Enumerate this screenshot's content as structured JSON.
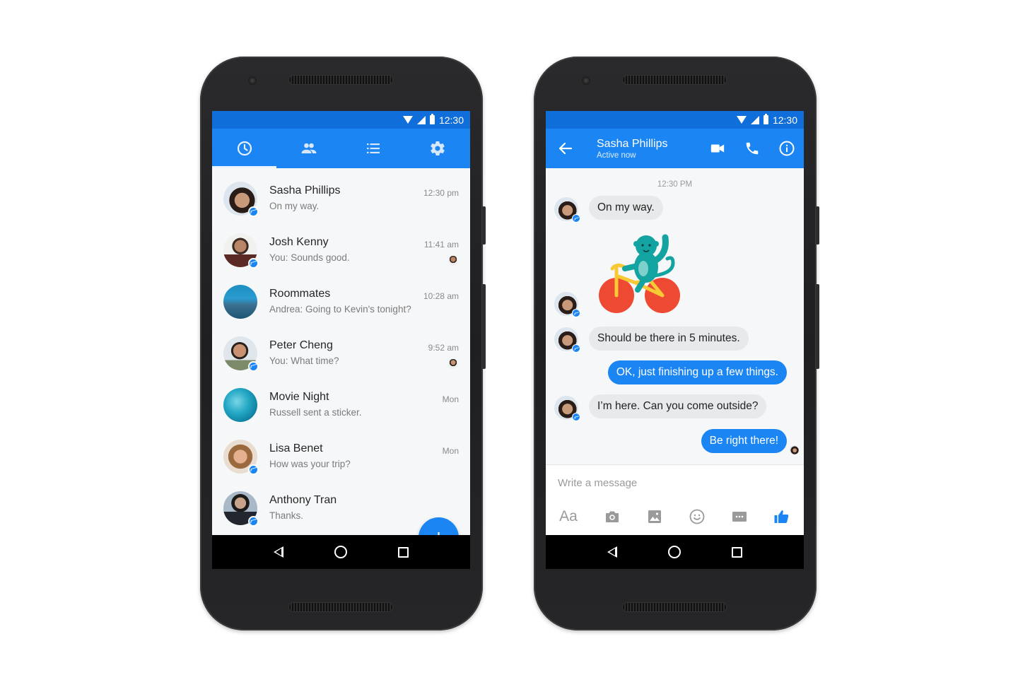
{
  "colors": {
    "accent": "#1a85f3",
    "statusbar": "#0f6ed9",
    "bubble_in": "#e8e9eb",
    "bubble_out": "#1a85f3",
    "phone_body": "#242426"
  },
  "status_bar": {
    "time": "12:30",
    "icons": [
      "wifi-icon",
      "signal-icon",
      "battery-icon"
    ]
  },
  "left_screen": {
    "tabs": [
      {
        "name": "recent",
        "icon": "clock-icon",
        "active": true
      },
      {
        "name": "people",
        "icon": "people-icon",
        "active": false
      },
      {
        "name": "groups",
        "icon": "list-icon",
        "active": false
      },
      {
        "name": "settings",
        "icon": "gear-icon",
        "active": false
      }
    ],
    "conversations": [
      {
        "name": "Sasha Phillips",
        "snippet": "On my way.",
        "time": "12:30 pm",
        "messenger_badge": true,
        "seen_avatar": false
      },
      {
        "name": "Josh Kenny",
        "snippet": "You: Sounds good.",
        "time": "11:41 am",
        "messenger_badge": true,
        "seen_avatar": true
      },
      {
        "name": "Roommates",
        "snippet": "Andrea: Going to Kevin's tonight?",
        "time": "10:28 am",
        "messenger_badge": false,
        "seen_avatar": false
      },
      {
        "name": "Peter Cheng",
        "snippet": "You: What time?",
        "time": "9:52 am",
        "messenger_badge": true,
        "seen_avatar": true
      },
      {
        "name": "Movie Night",
        "snippet": "Russell sent a sticker.",
        "time": "Mon",
        "messenger_badge": false,
        "seen_avatar": false
      },
      {
        "name": "Lisa Benet",
        "snippet": "How was your trip?",
        "time": "Mon",
        "messenger_badge": true,
        "seen_avatar": false
      },
      {
        "name": "Anthony Tran",
        "snippet": "Thanks.",
        "time": "",
        "messenger_badge": true,
        "seen_avatar": false
      }
    ],
    "fab_label": "+"
  },
  "right_screen": {
    "contact_name": "Sasha Phillips",
    "contact_status": "Active now",
    "header_actions": [
      "video-call-icon",
      "phone-icon",
      "info-icon"
    ],
    "timestamp": "12:30 PM",
    "messages": [
      {
        "from": "them",
        "type": "text",
        "text": "On my way."
      },
      {
        "from": "them",
        "type": "sticker",
        "text": "monkey-on-bicycle sticker"
      },
      {
        "from": "them",
        "type": "text",
        "text": "Should be there in 5 minutes."
      },
      {
        "from": "me",
        "type": "text",
        "text": "OK, just finishing up a few things."
      },
      {
        "from": "them",
        "type": "text",
        "text": "I’m here. Can you come outside?"
      },
      {
        "from": "me",
        "type": "text",
        "text": "Be right there!"
      }
    ],
    "composer": {
      "placeholder": "Write a message",
      "aa_label": "Aa",
      "tools": [
        "text-format-icon",
        "camera-icon",
        "image-icon",
        "emoji-icon",
        "more-icon",
        "thumbs-up-icon"
      ]
    }
  },
  "nav_bar": [
    "back-icon",
    "home-icon",
    "recents-icon"
  ]
}
